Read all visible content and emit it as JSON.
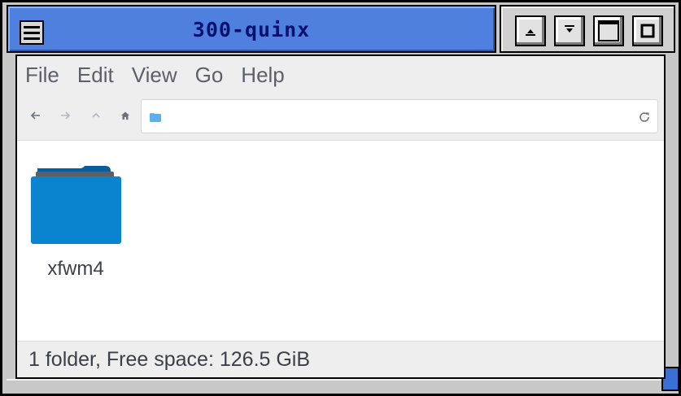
{
  "window": {
    "title": "300-quinx"
  },
  "menubar": {
    "items": [
      "File",
      "Edit",
      "View",
      "Go",
      "Help"
    ]
  },
  "toolbar": {
    "back_icon": "arrow-left-icon",
    "forward_icon": "arrow-right-icon",
    "up_icon": "arrow-up-icon",
    "home_icon": "home-icon",
    "reload_icon": "reload-icon",
    "path_value": ""
  },
  "files": [
    {
      "name": "xfwm4",
      "type": "folder",
      "color": "#0b84d0"
    }
  ],
  "status": {
    "text": "1 folder, Free space: 126.5 GiB"
  },
  "colors": {
    "titlebar": "#4f80dd",
    "title_text": "#0a1070",
    "folder": "#0b84d0",
    "folder_tab": "#0a5d9c"
  }
}
